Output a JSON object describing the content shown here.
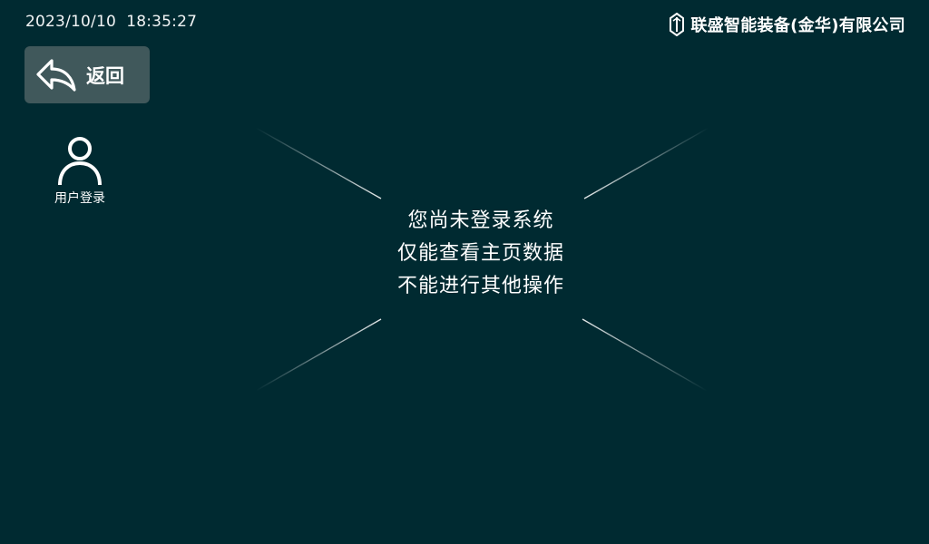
{
  "status_bar": {
    "datetime": "2023/10/10  18:35:27",
    "brand_name": "联盛智能装备(金华)有限公司"
  },
  "back_button": {
    "label": "返回",
    "icon": "back-arrow-icon"
  },
  "user_login": {
    "label": "用户登录",
    "icon": "user-icon"
  },
  "notice": {
    "lines": [
      "您尚未登录系统",
      "仅能查看主页数据",
      "不能进行其他操作"
    ]
  },
  "colors": {
    "background": "#002a31",
    "button_background": "#40585b",
    "text": "#ffffff"
  }
}
